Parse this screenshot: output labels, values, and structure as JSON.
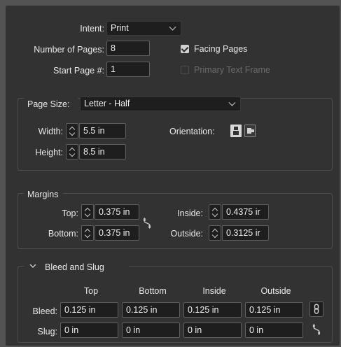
{
  "document": {
    "intent_label": "Intent:",
    "intent_value": "Print",
    "pages_label": "Number of Pages:",
    "pages_value": "8",
    "start_label": "Start Page #:",
    "start_value": "1",
    "facing_pages_label": "Facing Pages",
    "facing_pages_checked": true,
    "primary_text_frame_label": "Primary Text Frame",
    "primary_text_frame_checked": false
  },
  "page_size": {
    "label": "Page Size:",
    "value": "Letter - Half",
    "width_label": "Width:",
    "width_value": "5.5 in",
    "height_label": "Height:",
    "height_value": "8.5 in",
    "orientation_label": "Orientation:",
    "orientation_selected": "portrait"
  },
  "margins": {
    "title": "Margins",
    "top_label": "Top:",
    "top_value": "0.375 in",
    "bottom_label": "Bottom:",
    "bottom_value": "0.375 in",
    "inside_label": "Inside:",
    "inside_value": "0.4375 ir",
    "outside_label": "Outside:",
    "outside_value": "0.3125 ir"
  },
  "bleed_slug": {
    "title": "Bleed and Slug",
    "columns": [
      "Top",
      "Bottom",
      "Inside",
      "Outside"
    ],
    "bleed_label": "Bleed:",
    "bleed_values": [
      "0.125 in",
      "0.125 in",
      "0.125 in",
      "0.125 in"
    ],
    "slug_label": "Slug:",
    "slug_values": [
      "0 in",
      "0 in",
      "0 in",
      "0 in"
    ]
  },
  "icons": {
    "margin_link": "broken-chain-icon",
    "bleed_link": "chain-link-icon",
    "slug_link": "broken-chain-icon",
    "portrait": "portrait-orientation-icon",
    "landscape": "landscape-orientation-icon",
    "collapse": "chevron-down-icon"
  }
}
